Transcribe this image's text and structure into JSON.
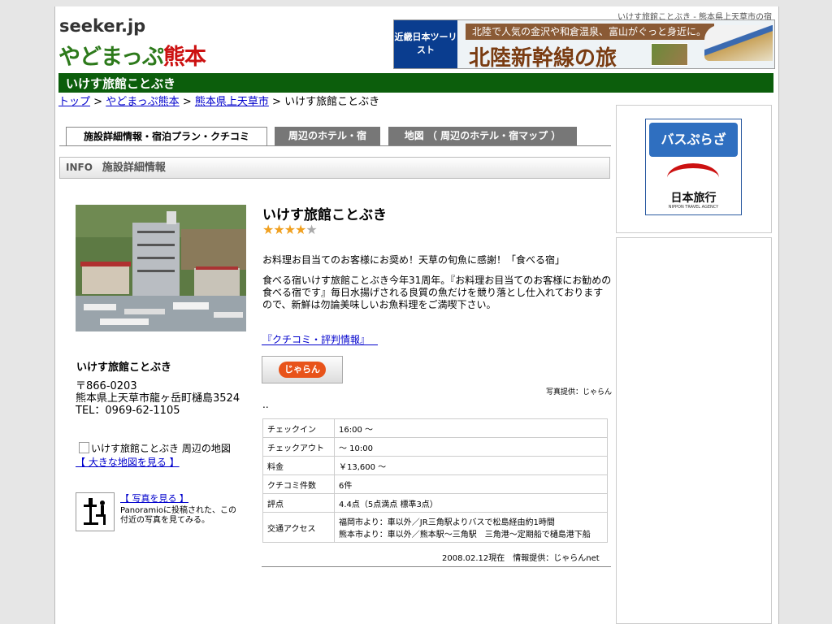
{
  "page": {
    "tagline": "いけす旅館ことぶき - 熊本県上天草市の宿",
    "logo_top": "seeker.jp",
    "logo_main_green": "やどまっぷ",
    "logo_main_red": "熊本",
    "title": "いけす旅館ことぶき"
  },
  "banner": {
    "brand": "近畿日本ツーリスト",
    "top_text": "北陸で人気の金沢や和倉温泉、富山がぐっと身近に。",
    "big_text": "北陸新幹線の旅"
  },
  "breadcrumb": {
    "top": "トップ",
    "sep": ">",
    "yadomap": "やどまっぷ熊本",
    "city": "熊本県上天草市",
    "current": "いけす旅館ことぶき"
  },
  "tabs": [
    {
      "label": "施設詳細情報・宿泊プラン・クチコミ"
    },
    {
      "label": "周辺のホテル・宿"
    },
    {
      "label": "地図 （ 周辺のホテル・宿マップ ）"
    }
  ],
  "infobar": {
    "tag": "INFO",
    "label": "施設詳細情報"
  },
  "hotel": {
    "name": "いけす旅館ことぶき",
    "postal": "〒866-0203",
    "address": "熊本県上天草市龍ヶ岳町樋島3524",
    "tel": "TEL：0969-62-1105",
    "map_alt": "いけす旅館ことぶき 周辺の地図",
    "map_link": "【 大きな地図を見る 】",
    "photo_link": "【 写真を見る 】",
    "panoramio_text": "Panoramioに投稿された、この付近の写真を見てみる。",
    "rating_stars": 4,
    "catch": "お料理お目当てのお客様にお奨め！天草の旬魚に感謝！「食べる宿」",
    "description": "食べる宿いけす旅館ことぶき今年31周年。『お料理お目当てのお客様にお勧めの食べる宿です』毎日水揚げされる良質の魚だけを競り落とし仕入れておりますので、新鮮は勿論美味しいお魚料理をご満喫下さい。",
    "review_link": "『クチコミ・評判情報』",
    "jalan_button": "じゃらん",
    "photo_credit": "写真提供：じゃらん",
    "dots": ".."
  },
  "info_table": [
    {
      "key": "チェックイン",
      "value": "16:00 〜"
    },
    {
      "key": "チェックアウト",
      "value": "〜 10:00"
    },
    {
      "key": "料金",
      "value": "￥13,600 〜"
    },
    {
      "key": "クチコミ件数",
      "value": "6件"
    },
    {
      "key": "評点",
      "value": "4.4点（5点満点 標準3点）"
    },
    {
      "key": "交通アクセス",
      "value": "福岡市より：車以外／JR三角駅よりバスで松島経由約1時間\n熊本市より：車以外／熊本駅〜三角駅　三角港〜定期船で樋島港下船"
    }
  ],
  "data_source": "2008.02.12現在　情報提供：じゃらんnet",
  "sidebar_ad": {
    "bus_plaza": "バスぷらざ",
    "nihon_ryoko": "日本旅行",
    "nihon_ryoko_en": "NIPPON TRAVEL AGENCY"
  },
  "colors": {
    "title_green": "#0c5e0c",
    "star": "#f0a020",
    "tab_inactive": "#777777"
  }
}
